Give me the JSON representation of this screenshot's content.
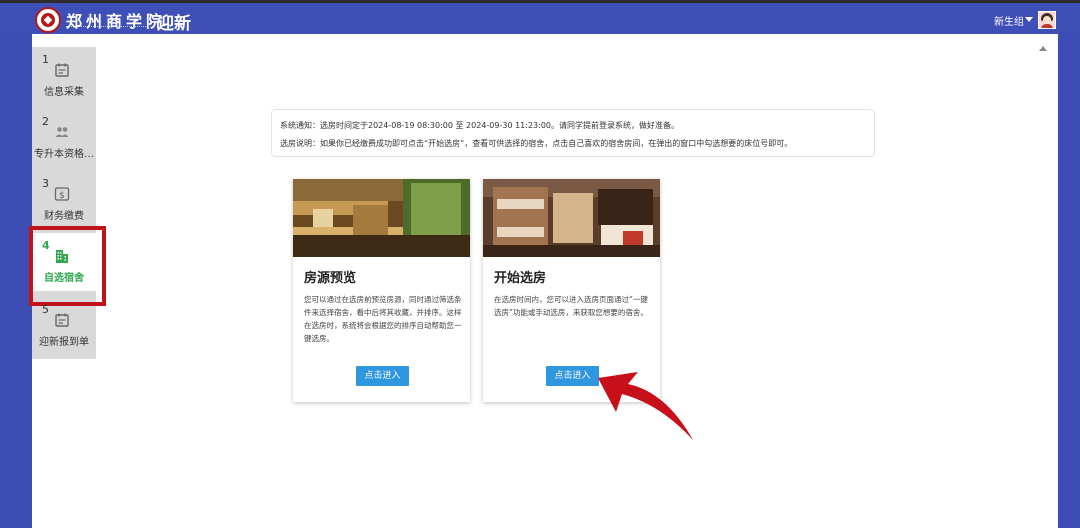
{
  "header": {
    "school_name": "郑州商学院",
    "app_title": "迎新",
    "user_name": "新生组"
  },
  "sidebar": {
    "items": [
      {
        "num": "1",
        "label": "信息采集",
        "icon": "calendar-icon"
      },
      {
        "num": "2",
        "label": "专升本资格…",
        "icon": "users-icon"
      },
      {
        "num": "3",
        "label": "财务缴费",
        "icon": "dollar-icon"
      },
      {
        "num": "4",
        "label": "自选宿舍",
        "icon": "building-icon",
        "active": true
      },
      {
        "num": "5",
        "label": "迎新报到单",
        "icon": "calendar-icon"
      }
    ]
  },
  "notice": {
    "line1": "系统通知：选房时间定于2024-08-19 08:30:00 至 2024-09-30 11:23:00。请同学提前登录系统，做好准备。",
    "line2": "选房说明：如果你已经缴费成功即可点击“开始选房”，查看可供选择的宿舍，点击自己喜欢的宿舍房间，在弹出的窗口中勾选想要的床位号即可。"
  },
  "cards": [
    {
      "title": "房源预览",
      "desc": "您可以通过在选房前预览房源，同时通过筛选条件来选择宿舍，看中后将其收藏，并排序。这样在选房时，系统将会根据您的排序自动帮助您一键选房。",
      "button": "点击进入"
    },
    {
      "title": "开始选房",
      "desc": "在选房时间内，您可以进入选房页面通过“一键选房”功能或手动选房，来获取您想要的宿舍。",
      "button": "点击进入"
    }
  ],
  "colors": {
    "header": "#3f4fb8",
    "active_step": "#2fa84f",
    "button": "#2f96e0",
    "highlight": "#c0141a"
  }
}
